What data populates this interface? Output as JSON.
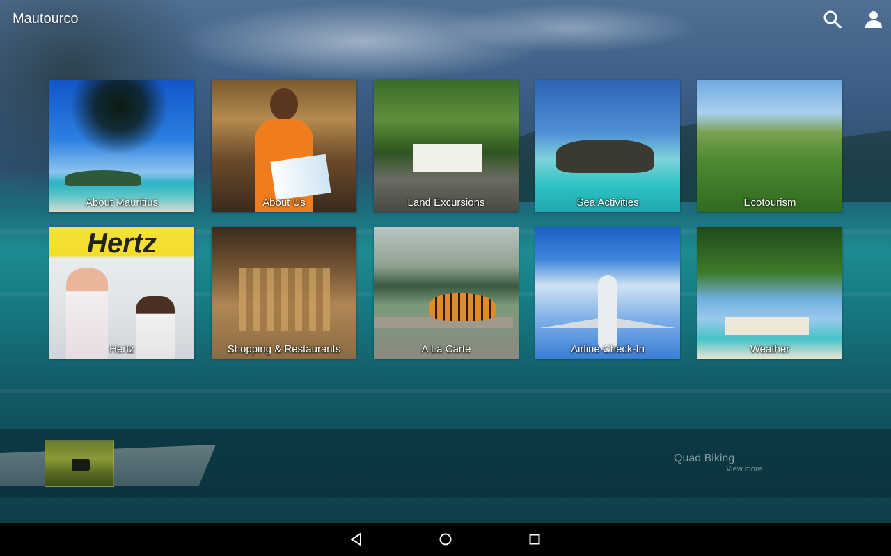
{
  "app": {
    "title": "Mautourco"
  },
  "toolbar": {
    "search_icon": "search-icon",
    "profile_icon": "person-icon"
  },
  "tiles": [
    {
      "label": "About Mauritius"
    },
    {
      "label": "About Us"
    },
    {
      "label": "Land Excursions"
    },
    {
      "label": "Sea Activities"
    },
    {
      "label": "Ecotourism"
    },
    {
      "label": "Hertz"
    },
    {
      "label": "Shopping & Restaurants"
    },
    {
      "label": "A La Carte"
    },
    {
      "label": "Airline Check-In"
    },
    {
      "label": "Weather"
    }
  ],
  "tile_art": {
    "hertz_sign": "Hertz"
  },
  "featured": {
    "title": "Quad Biking",
    "view_more": "View more"
  },
  "navbar": {
    "back_icon": "back-triangle-icon",
    "home_icon": "home-circle-icon",
    "recents_icon": "recents-square-icon"
  },
  "colors": {
    "text": "#ffffff",
    "navbar": "#000000",
    "featured_text": "#c8d2d7"
  }
}
